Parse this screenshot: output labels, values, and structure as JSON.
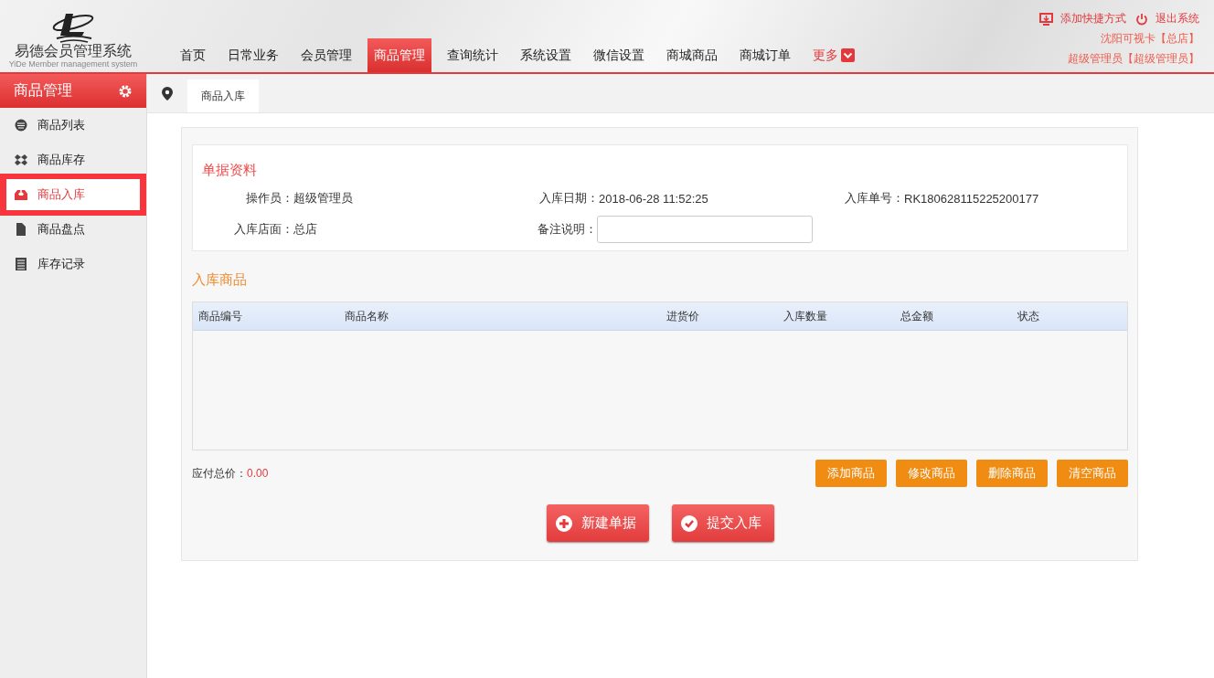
{
  "logo": {
    "title": "易德会员管理系统",
    "subtitle": "YiDe Member management system"
  },
  "nav": [
    {
      "label": "首页",
      "selected": false,
      "kind": "link"
    },
    {
      "label": "日常业务",
      "selected": false,
      "kind": "link"
    },
    {
      "label": "会员管理",
      "selected": false,
      "kind": "link"
    },
    {
      "label": "商品管理",
      "selected": true,
      "kind": "link"
    },
    {
      "label": "查询统计",
      "selected": false,
      "kind": "link"
    },
    {
      "label": "系统设置",
      "selected": false,
      "kind": "link"
    },
    {
      "label": "微信设置",
      "selected": false,
      "kind": "link"
    },
    {
      "label": "商城商品",
      "selected": false,
      "kind": "link"
    },
    {
      "label": "商城订单",
      "selected": false,
      "kind": "link"
    },
    {
      "label": "更多",
      "selected": false,
      "kind": "more"
    }
  ],
  "top_links": [
    {
      "label": "添加快捷方式",
      "kind": "shortcut"
    },
    {
      "label": "退出系统",
      "kind": "logout"
    }
  ],
  "user_lines": [
    "沈阳可视卡【总店】",
    "超级管理员【超级管理员】"
  ],
  "sidebar": {
    "title": "商品管理",
    "items": [
      {
        "label": "商品列表",
        "selected": false,
        "kind": "list"
      },
      {
        "label": "商品库存",
        "selected": false,
        "kind": "stock"
      },
      {
        "label": "商品入库",
        "selected": true,
        "kind": "inbound"
      },
      {
        "label": "商品盘点",
        "selected": false,
        "kind": "check"
      },
      {
        "label": "库存记录",
        "selected": false,
        "kind": "record"
      }
    ]
  },
  "page_tab": {
    "label": "商品入库"
  },
  "document": {
    "title": "单据资料",
    "fields": [
      {
        "label": "操作员：",
        "value": "超级管理员",
        "kind": "text"
      },
      {
        "label": "入库日期：",
        "value": "2018-06-28 11:52:25",
        "kind": "text"
      },
      {
        "label": "入库单号：",
        "value": "RK180628115225200177",
        "kind": "text"
      },
      {
        "label": "入库店面：",
        "value": "总店",
        "kind": "text"
      },
      {
        "label": "备注说明：",
        "kind": "input"
      }
    ]
  },
  "items": {
    "title": "入库商品",
    "columns": [
      "商品编号",
      "商品名称",
      "进货价",
      "入库数量",
      "总金额",
      "状态"
    ]
  },
  "total": {
    "label": "应付总价：",
    "value": "0.00"
  },
  "item_buttons": [
    "添加商品",
    "修改商品",
    "删除商品",
    "清空商品"
  ],
  "main_buttons": [
    {
      "label": "新建单据",
      "kind": "new"
    },
    {
      "label": "提交入库",
      "kind": "submit"
    }
  ]
}
